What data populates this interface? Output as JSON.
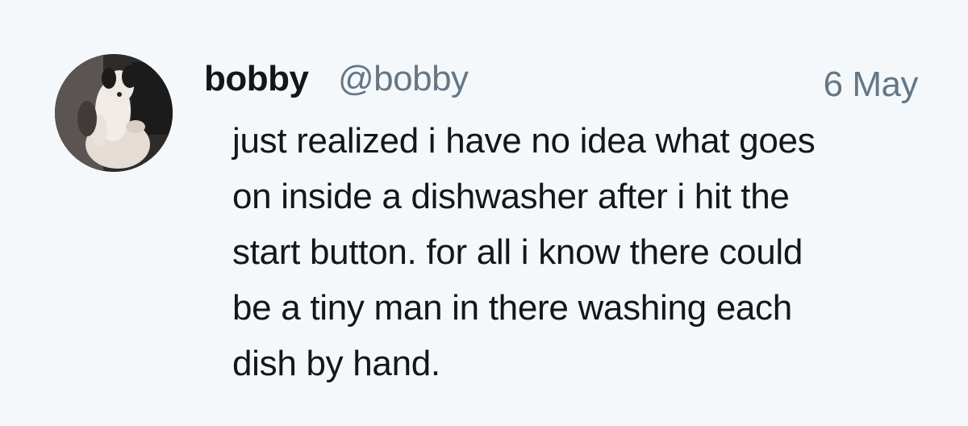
{
  "tweet": {
    "display_name": "bobby",
    "handle": "@bobby",
    "date": "6 May",
    "text": "just realized i have no idea what goes\non inside a dishwasher after i hit the\nstart button. for all i know there could\nbe a tiny man in there washing each\ndish by hand."
  },
  "colors": {
    "background": "#f5f8fa",
    "name": "#14171a",
    "secondary": "#657786"
  }
}
